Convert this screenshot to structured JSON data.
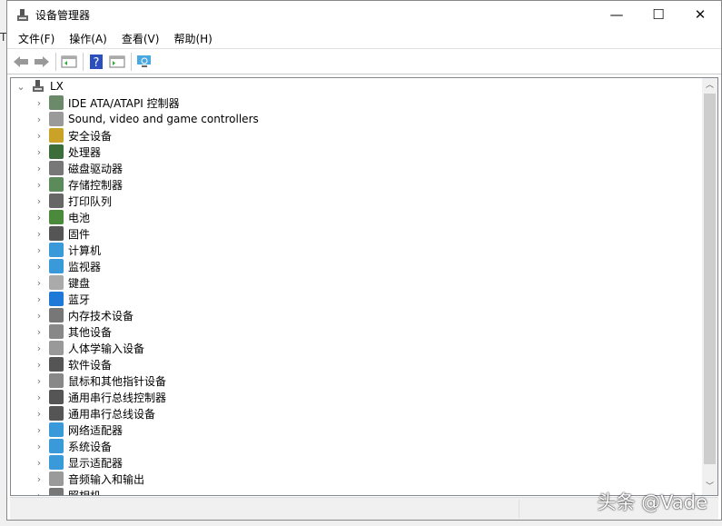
{
  "window": {
    "title": "设备管理器",
    "icon": "device-manager-icon",
    "controls": {
      "minimize": "—",
      "maximize": "☐",
      "close": "✕"
    }
  },
  "menu": [
    "文件(F)",
    "操作(A)",
    "查看(V)",
    "帮助(H)"
  ],
  "toolbar": [
    "back-icon",
    "forward-icon",
    "show-hide-console-tree-icon",
    "help-icon",
    "properties-icon",
    "scan-hardware-icon"
  ],
  "tree": {
    "root": "LX",
    "items": [
      {
        "label": "IDE ATA/ATAPI 控制器",
        "icon": "ide-controller-icon",
        "color": "#6a8a6a"
      },
      {
        "label": "Sound, video and game controllers",
        "icon": "speaker-icon",
        "color": "#9a9a9a"
      },
      {
        "label": "安全设备",
        "icon": "security-key-icon",
        "color": "#c9a227"
      },
      {
        "label": "处理器",
        "icon": "processor-icon",
        "color": "#3b6e3b"
      },
      {
        "label": "磁盘驱动器",
        "icon": "disk-drive-icon",
        "color": "#777777"
      },
      {
        "label": "存储控制器",
        "icon": "storage-controller-icon",
        "color": "#5b8a5b"
      },
      {
        "label": "打印队列",
        "icon": "printer-icon",
        "color": "#666666"
      },
      {
        "label": "电池",
        "icon": "battery-icon",
        "color": "#4a8a3a"
      },
      {
        "label": "固件",
        "icon": "firmware-icon",
        "color": "#555555"
      },
      {
        "label": "计算机",
        "icon": "computer-icon",
        "color": "#3a9ad9"
      },
      {
        "label": "监视器",
        "icon": "monitor-icon",
        "color": "#3a9ad9"
      },
      {
        "label": "键盘",
        "icon": "keyboard-icon",
        "color": "#aaaaaa"
      },
      {
        "label": "蓝牙",
        "icon": "bluetooth-icon",
        "color": "#1e7ad6"
      },
      {
        "label": "内存技术设备",
        "icon": "memory-device-icon",
        "color": "#777777"
      },
      {
        "label": "其他设备",
        "icon": "other-device-icon",
        "color": "#888888"
      },
      {
        "label": "人体学输入设备",
        "icon": "hid-icon",
        "color": "#999999"
      },
      {
        "label": "软件设备",
        "icon": "software-device-icon",
        "color": "#555555"
      },
      {
        "label": "鼠标和其他指针设备",
        "icon": "mouse-icon",
        "color": "#888888"
      },
      {
        "label": "通用串行总线控制器",
        "icon": "usb-icon",
        "color": "#555555"
      },
      {
        "label": "通用串行总线设备",
        "icon": "usb-device-icon",
        "color": "#555555"
      },
      {
        "label": "网络适配器",
        "icon": "network-adapter-icon",
        "color": "#3a9ad9"
      },
      {
        "label": "系统设备",
        "icon": "system-device-icon",
        "color": "#3a9ad9"
      },
      {
        "label": "显示适配器",
        "icon": "display-adapter-icon",
        "color": "#3a9ad9"
      },
      {
        "label": "音频输入和输出",
        "icon": "audio-io-icon",
        "color": "#9a9a9a"
      },
      {
        "label": "照相机",
        "icon": "camera-icon",
        "color": "#777777"
      }
    ]
  },
  "watermark": "头条 @Vade"
}
